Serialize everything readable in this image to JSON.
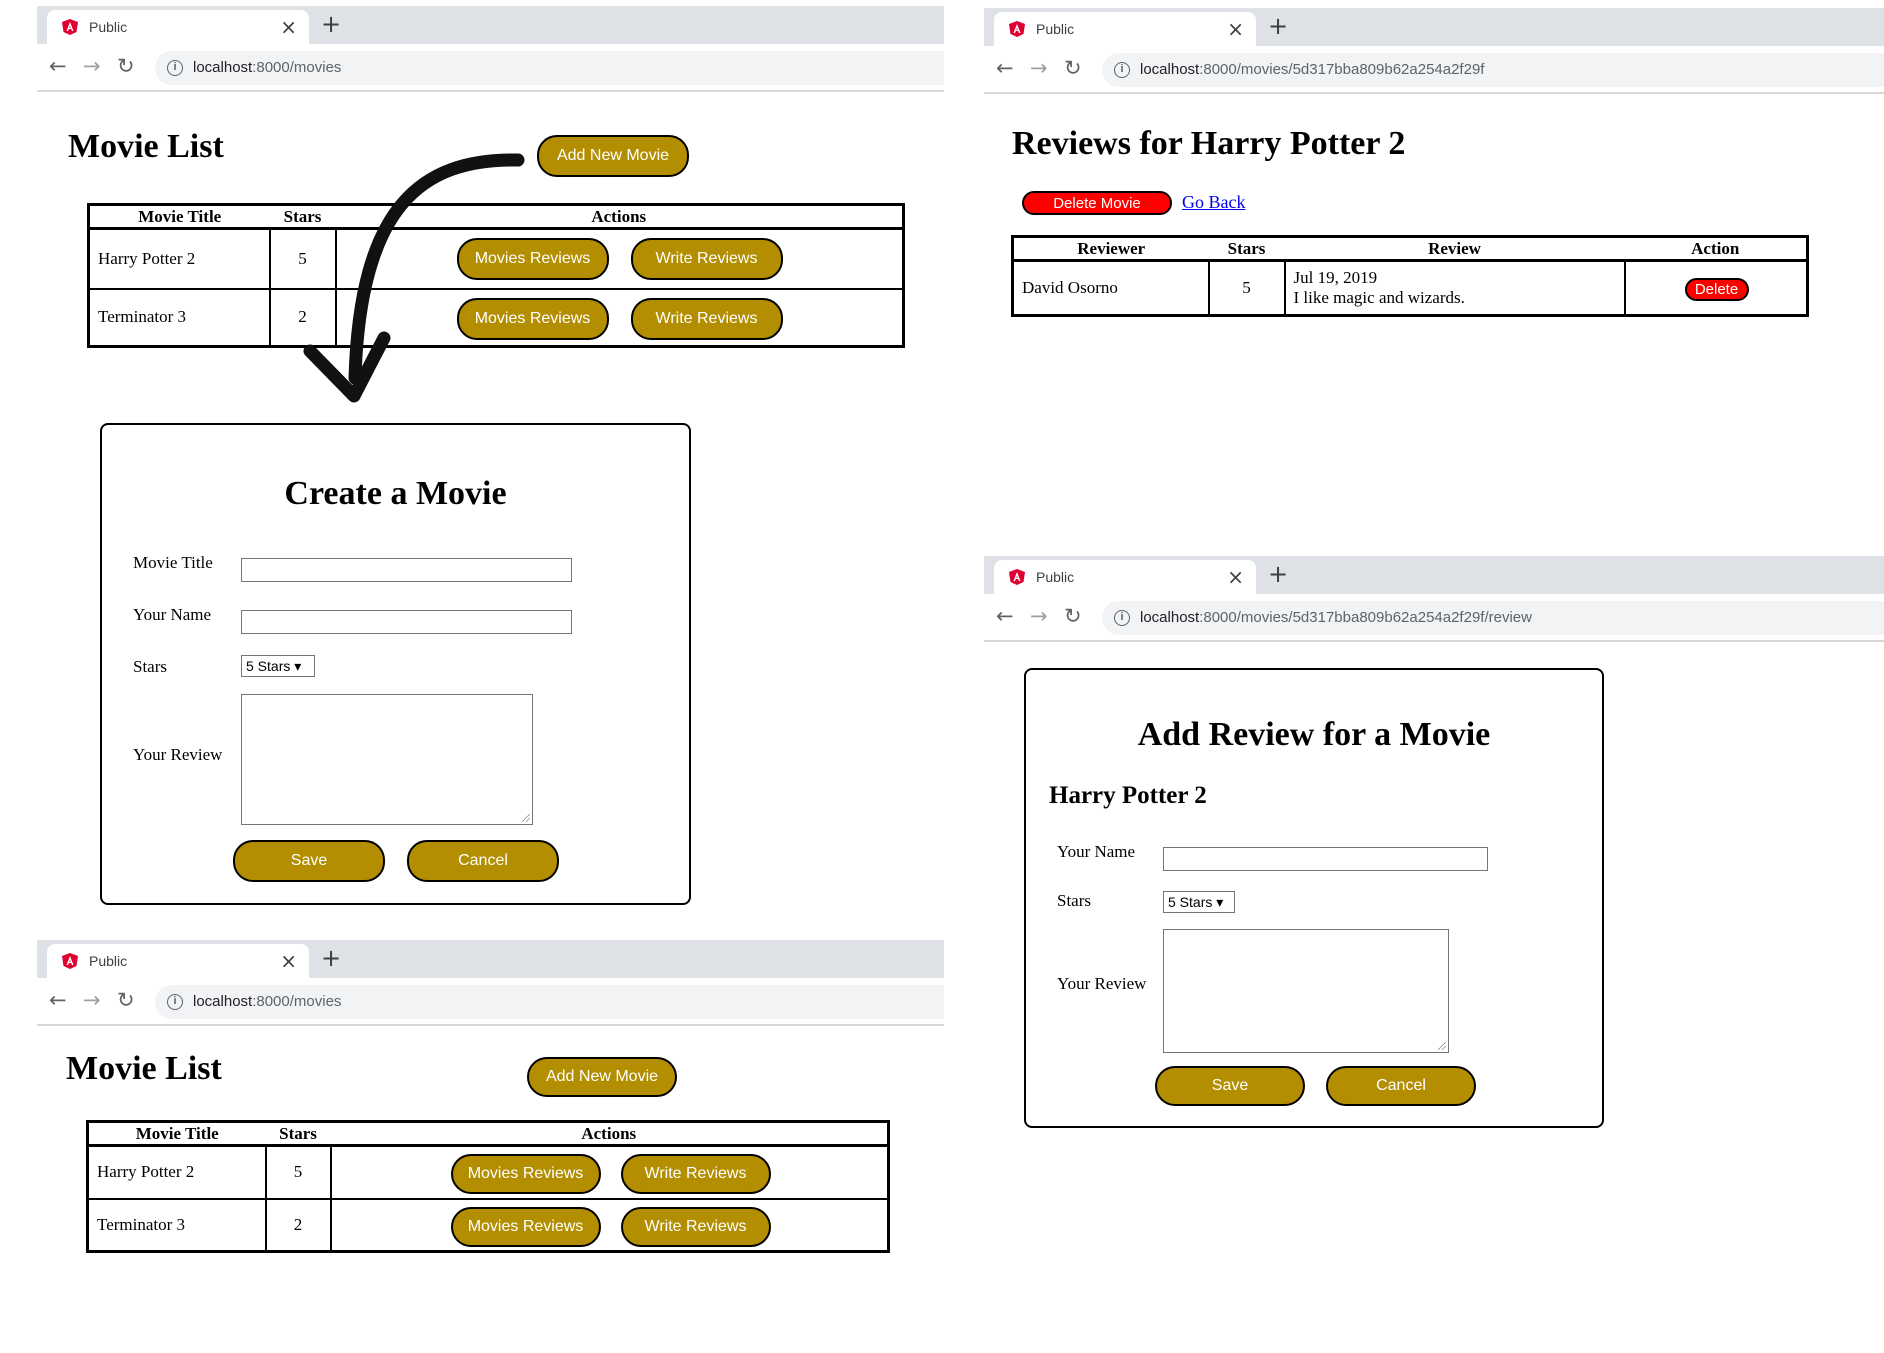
{
  "browser": {
    "tab_title": "Public",
    "close_glyph": "×",
    "new_tab_glyph": "+",
    "back_glyph": "←",
    "forward_glyph": "→",
    "reload_glyph": "↻",
    "info_glyph": "i",
    "host": "localhost",
    "url_movies_path": ":8000/movies",
    "url_reviews_path": ":8000/movies/5d317bba809b62a254a2f29f",
    "url_review_form_path": ":8000/movies/5d317bba809b62a254a2f29f/review",
    "tab_icon": "angular-shield-icon"
  },
  "movie_list": {
    "title": "Movie List",
    "add_button": "Add New Movie",
    "columns": [
      "Movie Title",
      "Stars",
      "Actions"
    ],
    "rows": [
      {
        "title": "Harry Potter 2",
        "stars": "5"
      },
      {
        "title": "Terminator 3",
        "stars": "2"
      }
    ],
    "reviews_button": "Movies Reviews",
    "write_button": "Write Reviews"
  },
  "create_movie": {
    "title": "Create a Movie",
    "movie_title_label": "Movie Title",
    "name_label": "Your Name",
    "stars_label": "Stars",
    "stars_value": "5 Stars ▾",
    "review_label": "Your Review",
    "save_button": "Save",
    "cancel_button": "Cancel"
  },
  "reviews_page": {
    "title": "Reviews for Harry Potter 2",
    "delete_movie_button": "Delete Movie",
    "go_back_link": "Go Back",
    "columns": [
      "Reviewer",
      "Stars",
      "Review",
      "Action"
    ],
    "rows": [
      {
        "reviewer": "David Osorno",
        "stars": "5",
        "date": "Jul 19, 2019",
        "text": "I like magic and wizards.",
        "action": "Delete"
      }
    ]
  },
  "add_review": {
    "title": "Add Review for a Movie",
    "movie_name": "Harry Potter 2",
    "name_label": "Your Name",
    "stars_label": "Stars",
    "stars_value": "5 Stars ▾",
    "review_label": "Your Review",
    "save_button": "Save",
    "cancel_button": "Cancel"
  },
  "colors": {
    "gold_button": "#b38e00",
    "red_button": "#ff0000",
    "link": "#0000ee"
  }
}
